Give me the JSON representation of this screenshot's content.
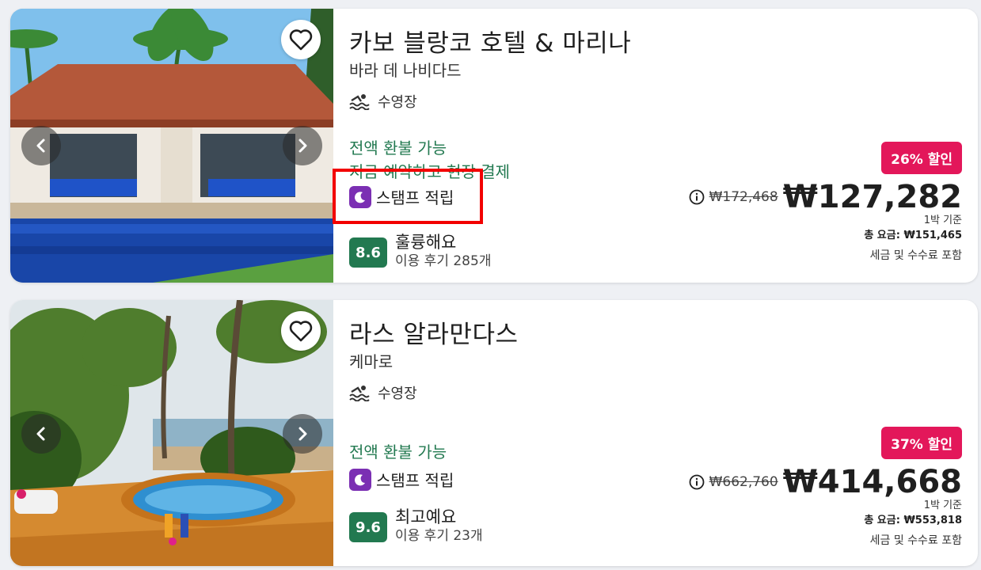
{
  "hotels": [
    {
      "name": "카보 블랑코 호텔 & 마리나",
      "location": "바라 데 나비다드",
      "amenity": "수영장",
      "refund": "전액 환불 가능",
      "pay_later": "지금 예약하고 현장 결제",
      "stamp": "스탬프 적립",
      "score": "8.6",
      "rating_word": "훌륭해요",
      "reviews": "이용 후기 285개",
      "discount": "26% 할인",
      "old_price": "₩172,468",
      "price": "₩127,282",
      "per_night": "1박 기준",
      "total": "총 요금: ₩151,465",
      "taxes": "세금 및 수수료 포함"
    },
    {
      "name": "라스 알라만다스",
      "location": "케마로",
      "amenity": "수영장",
      "refund": "전액 환불 가능",
      "stamp": "스탬프 적립",
      "score": "9.6",
      "rating_word": "최고예요",
      "reviews": "이용 후기 23개",
      "discount": "37% 할인",
      "old_price": "₩662,760",
      "price": "₩414,668",
      "per_night": "1박 기준",
      "total": "총 요금: ₩553,818",
      "taxes": "세금 및 수수료 포함"
    }
  ],
  "colors": {
    "accent_green": "#227950",
    "discount_red": "#e3175a",
    "stamp_purple": "#7b2fb3",
    "highlight": "#f20000"
  },
  "icons": [
    "heart-icon",
    "chevron-left-icon",
    "chevron-right-icon",
    "pool-icon",
    "moon-stamp-icon",
    "info-icon"
  ]
}
